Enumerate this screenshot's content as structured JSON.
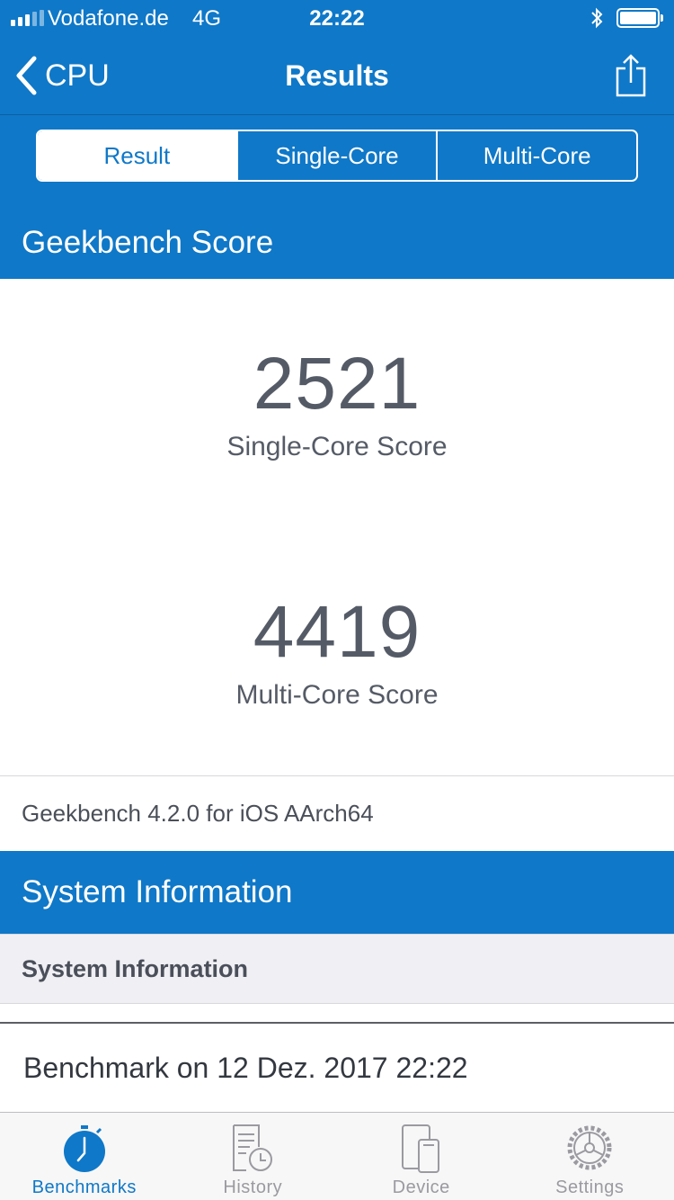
{
  "status_bar": {
    "carrier": "Vodafone.de",
    "network": "4G",
    "time": "22:22",
    "bluetooth_icon": "bluetooth-icon",
    "battery_level": 1.0
  },
  "nav": {
    "back_label": "CPU",
    "title": "Results",
    "share_icon": "share-icon"
  },
  "segments": [
    {
      "label": "Result",
      "active": true
    },
    {
      "label": "Single-Core",
      "active": false
    },
    {
      "label": "Multi-Core",
      "active": false
    }
  ],
  "score_section": {
    "header": "Geekbench Score",
    "single_core_score": "2521",
    "single_core_label": "Single-Core Score",
    "multi_core_score": "4419",
    "multi_core_label": "Multi-Core Score",
    "version": "Geekbench 4.2.0 for iOS AArch64"
  },
  "system_section": {
    "header": "System Information",
    "subheader": "System Information",
    "benchmark_row": "Benchmark on 12 Dez. 2017 22:22"
  },
  "tabbar": {
    "items": [
      {
        "label": "Benchmarks",
        "icon": "stopwatch-icon",
        "active": true
      },
      {
        "label": "History",
        "icon": "history-icon",
        "active": false
      },
      {
        "label": "Device",
        "icon": "device-icon",
        "active": false
      },
      {
        "label": "Settings",
        "icon": "gear-icon",
        "active": false
      }
    ]
  },
  "colors": {
    "accent": "#0f78c8",
    "text": "#555b66",
    "tab_inactive": "#9a9aa0"
  }
}
